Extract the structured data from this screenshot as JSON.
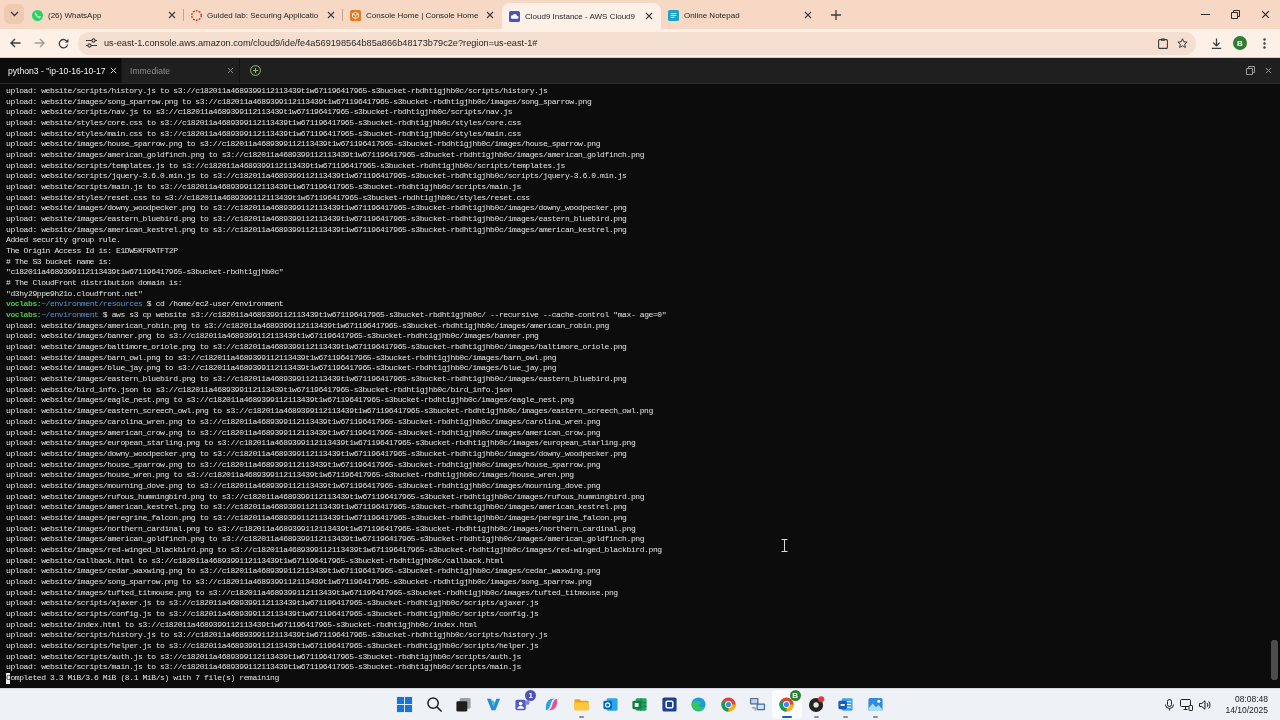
{
  "browser": {
    "tabs": [
      {
        "title": "(26) WhatsApp",
        "selected": false
      },
      {
        "title": "Guided lab: Securing Applicatio",
        "selected": false
      },
      {
        "title": "Console Home | Console Home",
        "selected": false
      },
      {
        "title": "Cloud9 Instance - AWS Cloud9",
        "selected": true
      },
      {
        "title": "Online Notepad",
        "selected": false
      }
    ],
    "back_disabled": false,
    "forward_disabled": true,
    "address": "us-east-1.console.aws.amazon.com/cloud9/ide/fe4a569198564b85a866b48173b79c2e?region=us-east-1#",
    "profile_initial": "B"
  },
  "ide": {
    "tabs": [
      {
        "label": "python3 - \"ip-10-16-10-17",
        "selected": true
      },
      {
        "label": "Immediate",
        "selected": false
      }
    ],
    "terminal": {
      "lines": [
        {
          "kind": "output",
          "cursor": false,
          "text": "upload: website/scripts/history.js to s3://c182011a4689399112113439t1w671196417965-s3bucket-rbdht1gjhb0c/scripts/history.js"
        },
        {
          "kind": "output",
          "cursor": false,
          "text": "upload: website/images/song_sparrow.png to s3://c182011a4689399112113439t1w671196417965-s3bucket-rbdht1gjhb0c/images/song_sparrow.png"
        },
        {
          "kind": "output",
          "cursor": false,
          "text": "upload: website/scripts/nav.js to s3://c182011a4689399112113439t1w671196417965-s3bucket-rbdht1gjhb0c/scripts/nav.js"
        },
        {
          "kind": "output",
          "cursor": false,
          "text": "upload: website/styles/core.css to s3://c182011a4689399112113439t1w671196417965-s3bucket-rbdht1gjhb0c/styles/core.css"
        },
        {
          "kind": "output",
          "cursor": false,
          "text": "upload: website/styles/main.css to s3://c182011a4689399112113439t1w671196417965-s3bucket-rbdht1gjhb0c/styles/main.css"
        },
        {
          "kind": "output",
          "cursor": false,
          "text": "upload: website/images/house_sparrow.png to s3://c182011a4689399112113439t1w671196417965-s3bucket-rbdht1gjhb0c/images/house_sparrow.png"
        },
        {
          "kind": "output",
          "cursor": false,
          "text": "upload: website/images/american_goldfinch.png to s3://c182011a4689399112113439t1w671196417965-s3bucket-rbdht1gjhb0c/images/american_goldfinch.png"
        },
        {
          "kind": "output",
          "cursor": false,
          "text": "upload: website/scripts/templates.js to s3://c182011a4689399112113439t1w671196417965-s3bucket-rbdht1gjhb0c/scripts/templates.js"
        },
        {
          "kind": "output",
          "cursor": false,
          "text": "upload: website/scripts/jquery-3.6.0.min.js to s3://c182011a4689399112113439t1w671196417965-s3bucket-rbdht1gjhb0c/scripts/jquery-3.6.0.min.js"
        },
        {
          "kind": "output",
          "cursor": false,
          "text": "upload: website/scripts/main.js to s3://c182011a4689399112113439t1w671196417965-s3bucket-rbdht1gjhb0c/scripts/main.js"
        },
        {
          "kind": "output",
          "cursor": false,
          "text": "upload: website/styles/reset.css to s3://c182011a4689399112113439t1w671196417965-s3bucket-rbdht1gjhb0c/styles/reset.css"
        },
        {
          "kind": "output",
          "cursor": false,
          "text": "upload: website/images/downy_woodpecker.png to s3://c182011a4689399112113439t1w671196417965-s3bucket-rbdht1gjhb0c/images/downy_woodpecker.png"
        },
        {
          "kind": "output",
          "cursor": false,
          "text": "upload: website/images/eastern_bluebird.png to s3://c182011a4689399112113439t1w671196417965-s3bucket-rbdht1gjhb0c/images/eastern_bluebird.png"
        },
        {
          "kind": "output",
          "cursor": false,
          "text": "upload: website/images/american_kestrel.png to s3://c182011a4689399112113439t1w671196417965-s3bucket-rbdht1gjhb0c/images/american_kestrel.png"
        },
        {
          "kind": "output",
          "cursor": false,
          "text": "Added security group rule."
        },
        {
          "kind": "output",
          "cursor": false,
          "text": "The Origin Access Id is: E1DW5KFRATFT2P"
        },
        {
          "kind": "output",
          "cursor": false,
          "text": "# The S3 bucket name is:"
        },
        {
          "kind": "output",
          "cursor": false,
          "text": "\"c182011a4689399112113439t1w671196417965-s3bucket-rbdht1gjhb0c\""
        },
        {
          "kind": "output",
          "cursor": false,
          "text": "# The CloudFront distribution domain is:"
        },
        {
          "kind": "output",
          "cursor": false,
          "text": "\"d3hy29ppe9h21o.cloudfront.net\""
        },
        {
          "kind": "prompt",
          "cursor": false,
          "user": "voclabs:",
          "path": "~/environment/resources",
          "command": "$ cd /home/ec2-user/environment"
        },
        {
          "kind": "prompt",
          "cursor": false,
          "user": "voclabs:",
          "path": "~/environment",
          "command": "$ aws s3 cp website s3://c182011a4689399112113439t1w671196417965-s3bucket-rbdht1gjhb0c/ --recursive --cache-control \"max- age=0\""
        },
        {
          "kind": "output",
          "cursor": false,
          "text": "upload: website/images/american_robin.png to s3://c182011a4689399112113439t1w671196417965-s3bucket-rbdht1gjhb0c/images/american_robin.png"
        },
        {
          "kind": "output",
          "cursor": false,
          "text": "upload: website/images/banner.png to s3://c182011a4689399112113439t1w671196417965-s3bucket-rbdht1gjhb0c/images/banner.png"
        },
        {
          "kind": "output",
          "cursor": false,
          "text": "upload: website/images/baltimore_oriole.png to s3://c182011a4689399112113439t1w671196417965-s3bucket-rbdht1gjhb0c/images/baltimore_oriole.png"
        },
        {
          "kind": "output",
          "cursor": false,
          "text": "upload: website/images/barn_owl.png to s3://c182011a4689399112113439t1w671196417965-s3bucket-rbdht1gjhb0c/images/barn_owl.png"
        },
        {
          "kind": "output",
          "cursor": false,
          "text": "upload: website/images/blue_jay.png to s3://c182011a4689399112113439t1w671196417965-s3bucket-rbdht1gjhb0c/images/blue_jay.png"
        },
        {
          "kind": "output",
          "cursor": false,
          "text": "upload: website/images/eastern_bluebird.png to s3://c182011a4689399112113439t1w671196417965-s3bucket-rbdht1gjhb0c/images/eastern_bluebird.png"
        },
        {
          "kind": "output",
          "cursor": false,
          "text": "upload: website/bird_info.json to s3://c182011a4689399112113439t1w671196417965-s3bucket-rbdht1gjhb0c/bird_info.json"
        },
        {
          "kind": "output",
          "cursor": false,
          "text": "upload: website/images/eagle_nest.png to s3://c182011a4689399112113439t1w671196417965-s3bucket-rbdht1gjhb0c/images/eagle_nest.png"
        },
        {
          "kind": "output",
          "cursor": false,
          "text": "upload: website/images/eastern_screech_owl.png to s3://c182011a4689399112113439t1w671196417965-s3bucket-rbdht1gjhb0c/images/eastern_screech_owl.png"
        },
        {
          "kind": "output",
          "cursor": false,
          "text": "upload: website/images/carolina_wren.png to s3://c182011a4689399112113439t1w671196417965-s3bucket-rbdht1gjhb0c/images/carolina_wren.png"
        },
        {
          "kind": "output",
          "cursor": false,
          "text": "upload: website/images/american_crow.png to s3://c182011a4689399112113439t1w671196417965-s3bucket-rbdht1gjhb0c/images/american_crow.png"
        },
        {
          "kind": "output",
          "cursor": false,
          "text": "upload: website/images/european_starling.png to s3://c182011a4689399112113439t1w671196417965-s3bucket-rbdht1gjhb0c/images/european_starling.png"
        },
        {
          "kind": "output",
          "cursor": false,
          "text": "upload: website/images/downy_woodpecker.png to s3://c182011a4689399112113439t1w671196417965-s3bucket-rbdht1gjhb0c/images/downy_woodpecker.png"
        },
        {
          "kind": "output",
          "cursor": false,
          "text": "upload: website/images/house_sparrow.png to s3://c182011a4689399112113439t1w671196417965-s3bucket-rbdht1gjhb0c/images/house_sparrow.png"
        },
        {
          "kind": "output",
          "cursor": false,
          "text": "upload: website/images/house_wren.png to s3://c182011a4689399112113439t1w671196417965-s3bucket-rbdht1gjhb0c/images/house_wren.png"
        },
        {
          "kind": "output",
          "cursor": false,
          "text": "upload: website/images/mourning_dove.png to s3://c182011a4689399112113439t1w671196417965-s3bucket-rbdht1gjhb0c/images/mourning_dove.png"
        },
        {
          "kind": "output",
          "cursor": false,
          "text": "upload: website/images/rufous_hummingbird.png to s3://c182011a4689399112113439t1w671196417965-s3bucket-rbdht1gjhb0c/images/rufous_hummingbird.png"
        },
        {
          "kind": "output",
          "cursor": false,
          "text": "upload: website/images/american_kestrel.png to s3://c182011a4689399112113439t1w671196417965-s3bucket-rbdht1gjhb0c/images/american_kestrel.png"
        },
        {
          "kind": "output",
          "cursor": false,
          "text": "upload: website/images/peregrine_falcon.png to s3://c182011a4689399112113439t1w671196417965-s3bucket-rbdht1gjhb0c/images/peregrine_falcon.png"
        },
        {
          "kind": "output",
          "cursor": false,
          "text": "upload: website/images/northern_cardinal.png to s3://c182011a4689399112113439t1w671196417965-s3bucket-rbdht1gjhb0c/images/northern_cardinal.png"
        },
        {
          "kind": "output",
          "cursor": false,
          "text": "upload: website/images/american_goldfinch.png to s3://c182011a4689399112113439t1w671196417965-s3bucket-rbdht1gjhb0c/images/american_goldfinch.png"
        },
        {
          "kind": "output",
          "cursor": false,
          "text": "upload: website/images/red-winged_blackbird.png to s3://c182011a4689399112113439t1w671196417965-s3bucket-rbdht1gjhb0c/images/red-winged_blackbird.png"
        },
        {
          "kind": "output",
          "cursor": false,
          "text": "upload: website/callback.html to s3://c182011a4689399112113439t1w671196417965-s3bucket-rbdht1gjhb0c/callback.html"
        },
        {
          "kind": "output",
          "cursor": false,
          "text": "upload: website/images/cedar_waxwing.png to s3://c182011a4689399112113439t1w671196417965-s3bucket-rbdht1gjhb0c/images/cedar_waxwing.png"
        },
        {
          "kind": "output",
          "cursor": false,
          "text": "upload: website/images/song_sparrow.png to s3://c182011a4689399112113439t1w671196417965-s3bucket-rbdht1gjhb0c/images/song_sparrow.png"
        },
        {
          "kind": "output",
          "cursor": false,
          "text": "upload: website/images/tufted_titmouse.png to s3://c182011a4689399112113439t1w671196417965-s3bucket-rbdht1gjhb0c/images/tufted_titmouse.png"
        },
        {
          "kind": "output",
          "cursor": false,
          "text": "upload: website/scripts/ajaxer.js to s3://c182011a4689399112113439t1w671196417965-s3bucket-rbdht1gjhb0c/scripts/ajaxer.js"
        },
        {
          "kind": "output",
          "cursor": false,
          "text": "upload: website/scripts/config.js to s3://c182011a4689399112113439t1w671196417965-s3bucket-rbdht1gjhb0c/scripts/config.js"
        },
        {
          "kind": "output",
          "cursor": false,
          "text": "upload: website/index.html to s3://c182011a4689399112113439t1w671196417965-s3bucket-rbdht1gjhb0c/index.html"
        },
        {
          "kind": "output",
          "cursor": false,
          "text": "upload: website/scripts/history.js to s3://c182011a4689399112113439t1w671196417965-s3bucket-rbdht1gjhb0c/scripts/history.js"
        },
        {
          "kind": "output",
          "cursor": false,
          "text": "upload: website/scripts/helper.js to s3://c182011a4689399112113439t1w671196417965-s3bucket-rbdht1gjhb0c/scripts/helper.js"
        },
        {
          "kind": "output",
          "cursor": false,
          "text": "upload: website/scripts/auth.js to s3://c182011a4689399112113439t1w671196417965-s3bucket-rbdht1gjhb0c/scripts/auth.js"
        },
        {
          "kind": "output",
          "cursor": false,
          "text": "upload: website/scripts/main.js to s3://c182011a4689399112113439t1w671196417965-s3bucket-rbdht1gjhb0c/scripts/main.js"
        },
        {
          "kind": "output",
          "cursor": true,
          "text": "Completed 3.3 MiB/3.6 MiB (8.1 MiB/s) with 7 file(s) remaining"
        }
      ]
    }
  },
  "taskbar": {
    "apps": [
      {
        "selected": false,
        "running": false
      },
      {
        "selected": false,
        "running": false
      },
      {
        "selected": false,
        "running": false
      },
      {
        "selected": false,
        "running": false
      },
      {
        "selected": false,
        "running": false,
        "badge": "1"
      },
      {
        "selected": false,
        "running": false
      },
      {
        "selected": false,
        "running": true
      },
      {
        "selected": false,
        "running": false
      },
      {
        "selected": false,
        "running": false
      },
      {
        "selected": false,
        "running": false
      },
      {
        "selected": false,
        "running": false
      },
      {
        "selected": false,
        "running": false
      },
      {
        "selected": false,
        "running": false
      },
      {
        "selected": true,
        "running": true,
        "badge": "B"
      },
      {
        "selected": false,
        "running": true
      },
      {
        "selected": false,
        "running": true
      },
      {
        "selected": false,
        "running": true
      }
    ],
    "time": "08:08:48",
    "date": "14/10/2025"
  }
}
